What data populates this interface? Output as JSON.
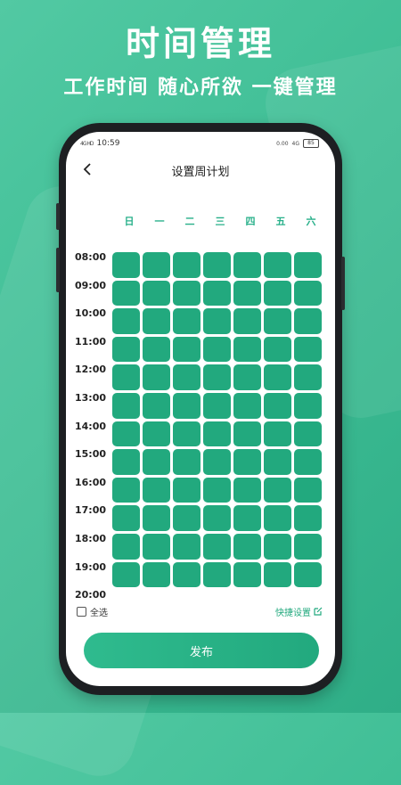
{
  "promo": {
    "headline": "时间管理",
    "subline": "工作时间 随心所欲 一键管理"
  },
  "statusbar": {
    "signal": "4G HD",
    "time": "10:59",
    "net_speed": "0.00",
    "network": "4G",
    "battery": "85"
  },
  "header": {
    "title": "设置周计划"
  },
  "days": [
    "日",
    "一",
    "二",
    "三",
    "四",
    "五",
    "六"
  ],
  "time_slots": [
    "08:00",
    "09:00",
    "10:00",
    "11:00",
    "12:00",
    "13:00",
    "14:00",
    "15:00",
    "16:00",
    "17:00",
    "18:00",
    "19:00",
    "20:00"
  ],
  "footer": {
    "select_all": "全选",
    "quick_set": "快捷设置",
    "publish": "发布"
  },
  "colors": {
    "accent": "#22a97e",
    "background": "#3fbe95"
  }
}
